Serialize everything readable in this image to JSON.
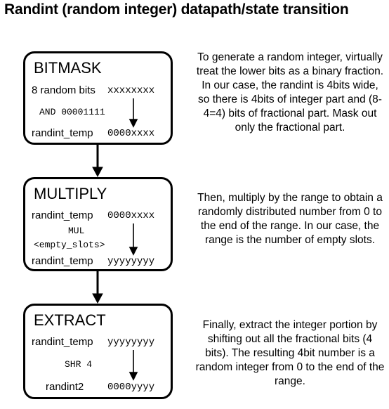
{
  "title": "Randint (random integer) datapath/state transition",
  "stages": [
    {
      "name": "BITMASK",
      "row1": {
        "label": "8 random bits",
        "value": "xxxxxxxx"
      },
      "op": [
        "AND 00001111"
      ],
      "row2": {
        "label": "randint_temp",
        "value": "0000xxxx"
      },
      "description": "To generate a random integer, virtually treat the lower bits as a binary fraction. In our case, the randint is 4bits wide, so there is 4bits of integer part and (8-4=4) bits of fractional part. Mask out only the fractional part."
    },
    {
      "name": "MULTIPLY",
      "row1": {
        "label": "randint_temp",
        "value": "0000xxxx"
      },
      "op": [
        "MUL",
        "<empty_slots>"
      ],
      "row2": {
        "label": "randint_temp",
        "value": "yyyyyyyy"
      },
      "description": "Then, multiply by the range to obtain a randomly distributed number from 0 to the end of the range. In our case, the range is the number of empty slots."
    },
    {
      "name": "EXTRACT",
      "row1": {
        "label": "randint_temp",
        "value": "yyyyyyyy"
      },
      "op": [
        "SHR 4"
      ],
      "row2": {
        "label": "randint2",
        "value": "0000yyyy"
      },
      "description": "Finally, extract the integer portion by shifting out all the fractional bits (4 bits). The resulting 4bit number is a random integer from 0 to the end of the range."
    }
  ]
}
